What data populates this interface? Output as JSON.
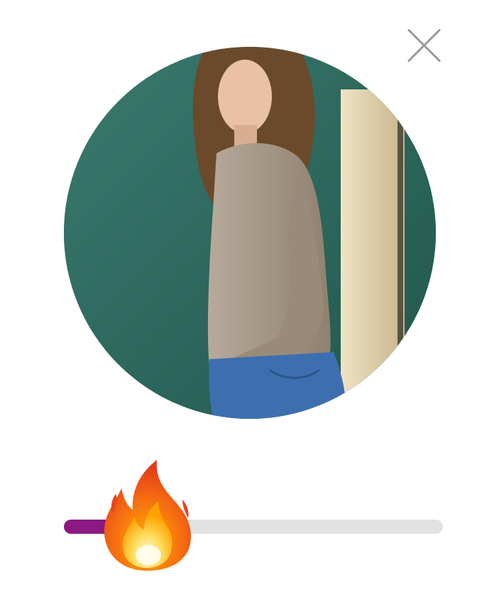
{
  "close": {
    "icon": "close-icon"
  },
  "photo": {
    "icon": "profile-photo",
    "colors": {
      "wall": "#2f6a60",
      "sweater": "#a89a89",
      "jeans": "#3d6fb0",
      "hair": "#6b4a2c",
      "door": "#d8c8a4"
    }
  },
  "rating_slider": {
    "value": 0.2,
    "thumb_icon": "fire-emoji-icon",
    "colors": {
      "fill": "#8a1a82",
      "track": "#e2e2e2"
    }
  }
}
